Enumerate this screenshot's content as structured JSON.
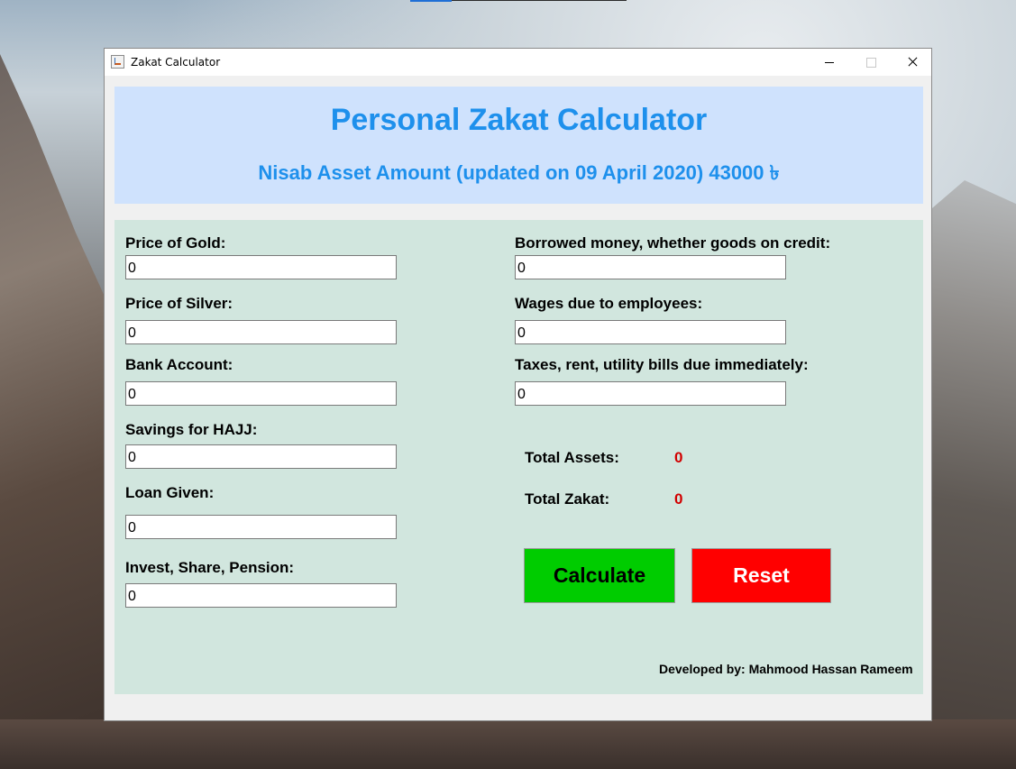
{
  "window": {
    "title": "Zakat Calculator"
  },
  "header": {
    "title": "Personal Zakat Calculator",
    "subtitle": "Nisab Asset Amount (updated on 09 April 2020) 43000 ৳"
  },
  "left_fields": [
    {
      "label": "Price of Gold:",
      "value": "0"
    },
    {
      "label": "Price of Silver:",
      "value": "0"
    },
    {
      "label": "Bank Account:",
      "value": "0"
    },
    {
      "label": "Savings for HAJJ:",
      "value": "0"
    },
    {
      "label": "Loan Given:",
      "value": "0"
    },
    {
      "label": "Invest, Share, Pension:",
      "value": "0"
    }
  ],
  "right_fields": [
    {
      "label": "Borrowed money, whether goods on credit:",
      "value": "0"
    },
    {
      "label": "Wages due to employees:",
      "value": "0"
    },
    {
      "label": "Taxes, rent, utility bills due immediately:",
      "value": "0"
    }
  ],
  "summary": {
    "total_assets_label": "Total Assets:",
    "total_assets_value": "0",
    "total_zakat_label": "Total Zakat:",
    "total_zakat_value": "0"
  },
  "buttons": {
    "calculate_label": "Calculate",
    "reset_label": "Reset"
  },
  "footer": {
    "credit": "Developed by: Mahmood Hassan Rameem"
  },
  "colors": {
    "header_bg": "#cfe2fd",
    "header_text": "#1e90ec",
    "form_bg": "#d1e6de",
    "calculate_bg": "#00cc00",
    "reset_bg": "#ff0000",
    "value_red": "#d10000"
  }
}
